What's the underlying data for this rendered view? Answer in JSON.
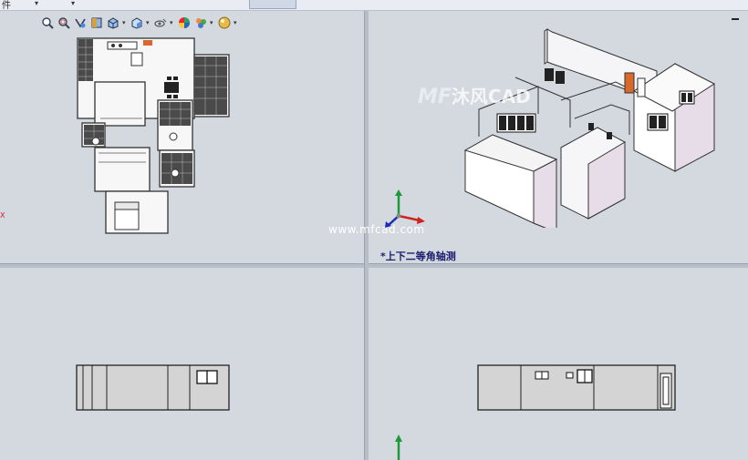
{
  "menubar": {
    "fragment": "件"
  },
  "toolbar": {
    "icons": [
      "zoom-to-fit-icon",
      "zoom-area-icon",
      "previous-view-icon",
      "section-view-icon",
      "view-orientation-icon",
      "display-style-icon",
      "hide-show-icon",
      "edit-appearance-icon",
      "apply-scene-icon",
      "view-settings-icon"
    ]
  },
  "watermark": {
    "url": "www.mfcad.com",
    "logo_text": "沐风CAD",
    "logo_mark": "MF"
  },
  "views": {
    "top_right_label": "*上下二等角轴测"
  },
  "axes": {
    "x": "X"
  },
  "colors": {
    "background": "#d4d9e0",
    "wall": "#ffffff",
    "wall_shade": "#e7dde8",
    "floor_tile": "#3b3b3b",
    "axis_x": "#d02020",
    "axis_y": "#1a9a3a",
    "axis_z": "#1a2ab8"
  }
}
